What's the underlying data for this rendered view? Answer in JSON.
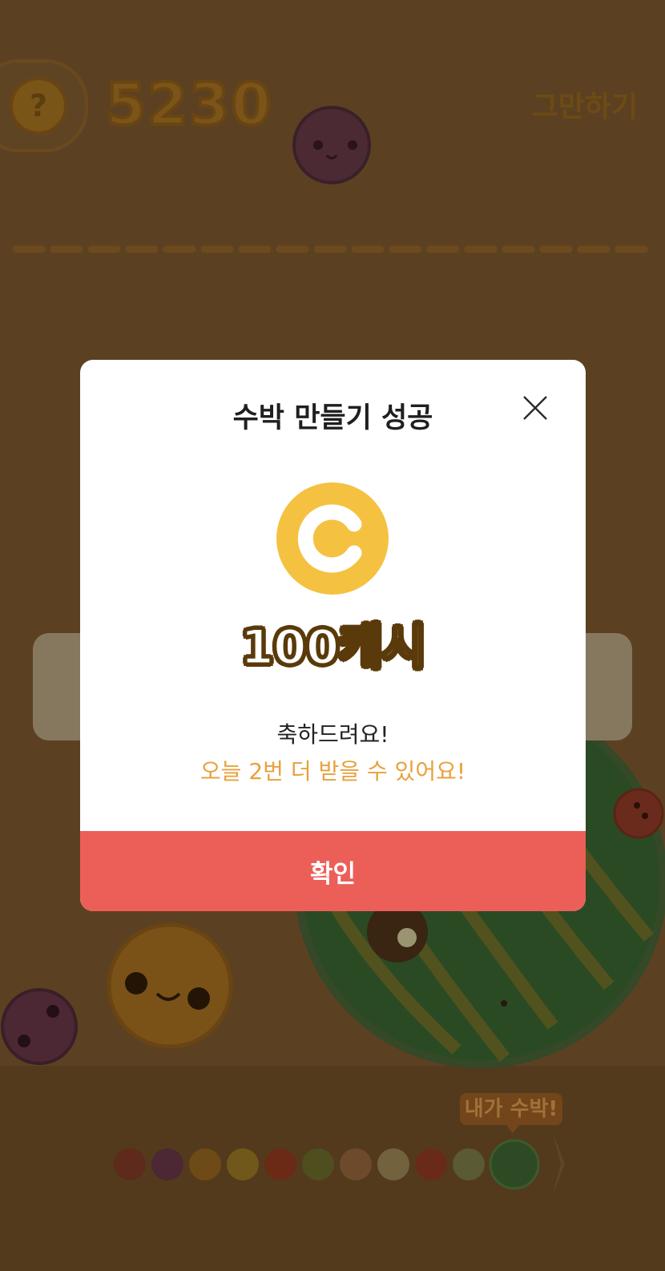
{
  "game": {
    "score": "5230",
    "quit_label": "그만하기",
    "help_glyph": "?",
    "next_bubble": "내가 수박!",
    "help_icon": "question-mark-icon",
    "fruit_sequence": [
      "cherry",
      "grape",
      "tangerine",
      "lemon",
      "apple",
      "kiwi",
      "peach",
      "pear",
      "tomato",
      "melon",
      "watermelon"
    ]
  },
  "dialog": {
    "title": "수박 만들기 성공",
    "close_icon": "close-icon",
    "coin_icon": "cash-coin-icon",
    "coin_letter": "C",
    "reward": "100캐시",
    "message": "축하드려요!",
    "remaining": "오늘 2번 더 받을 수 있어요!",
    "confirm": "확인"
  },
  "colors": {
    "overlay_bg": "#5b4122",
    "coin": "#f5c141",
    "confirm_bg": "#ec5f59",
    "highlight_text": "#e8a13c",
    "dialog_bg": "#ffffff"
  }
}
